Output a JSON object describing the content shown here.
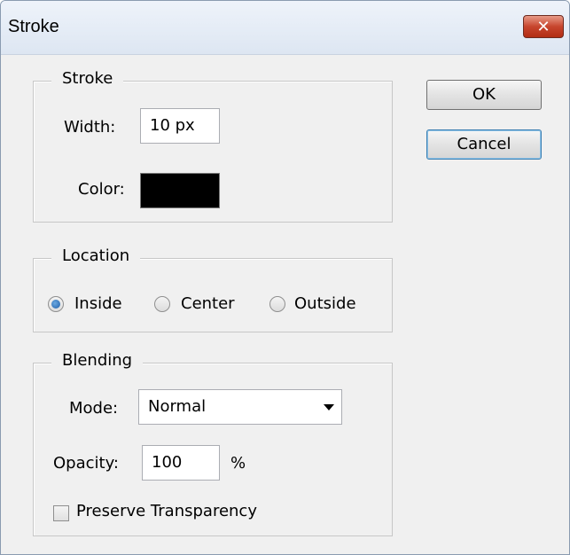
{
  "window": {
    "title": "Stroke",
    "close_glyph": "✕"
  },
  "stroke_group": {
    "label": "Stroke",
    "width_label": "Width:",
    "width_value": "10 px",
    "color_label": "Color:",
    "color_value": "#000000"
  },
  "location_group": {
    "label": "Location",
    "options": [
      {
        "label": "Inside",
        "checked": true
      },
      {
        "label": "Center",
        "checked": false
      },
      {
        "label": "Outside",
        "checked": false
      }
    ]
  },
  "blending_group": {
    "label": "Blending",
    "mode_label": "Mode:",
    "mode_value": "Normal",
    "opacity_label": "Opacity:",
    "opacity_value": "100",
    "opacity_unit": "%",
    "preserve_label": "Preserve Transparency",
    "preserve_checked": false
  },
  "buttons": {
    "ok": "OK",
    "cancel": "Cancel"
  },
  "icons": {
    "close": "close-icon",
    "dropdown": "chevron-down-icon"
  },
  "colors": {
    "accent": "#3c7fb1",
    "close_red": "#c7452d"
  }
}
